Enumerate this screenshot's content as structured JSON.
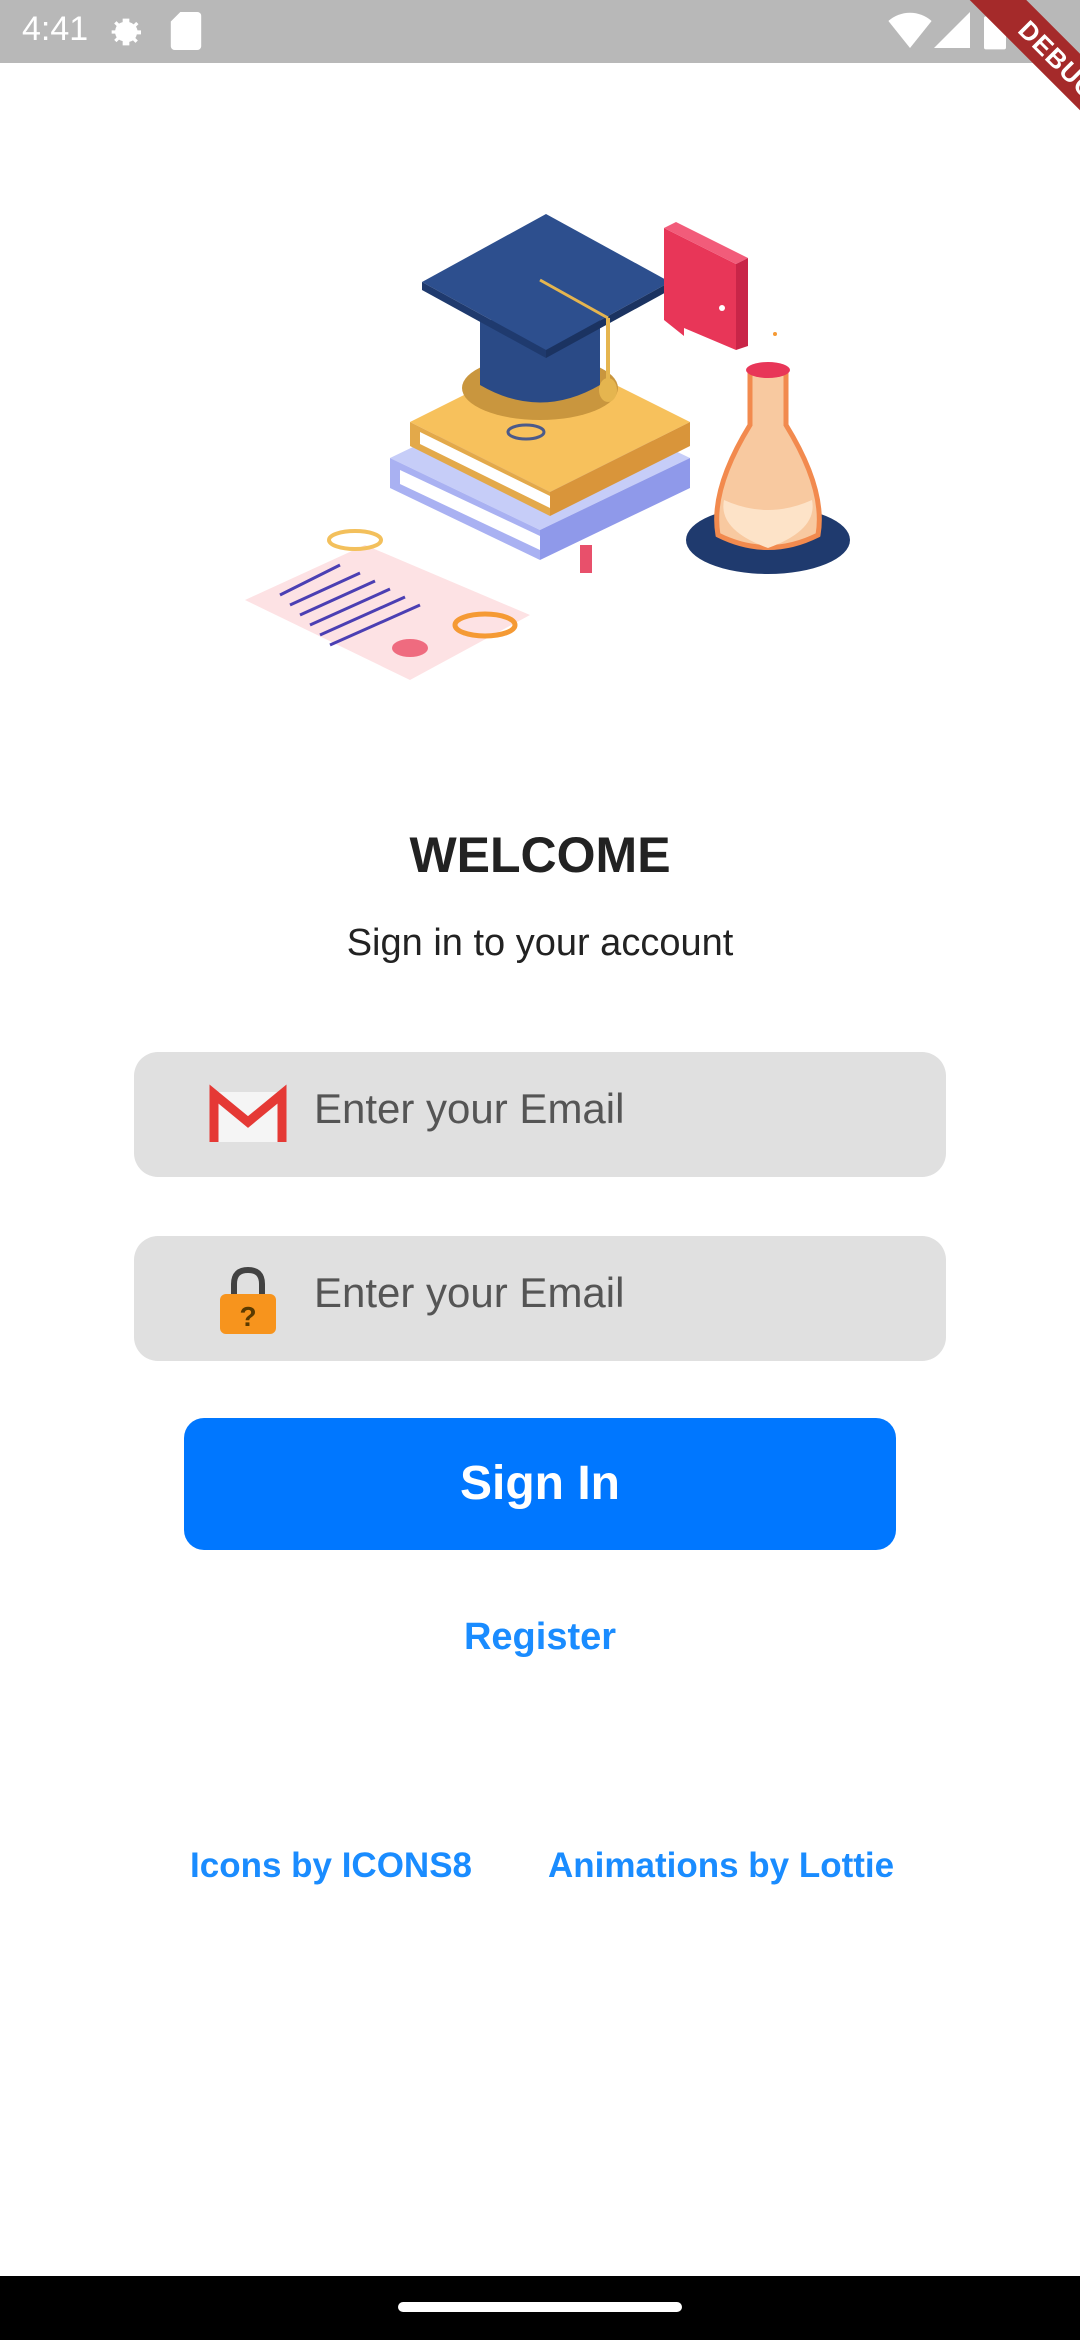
{
  "status_bar": {
    "time": "4:41",
    "icons": [
      "settings-gear-icon",
      "sd-card-icon",
      "wifi-icon",
      "signal-icon",
      "battery-icon"
    ]
  },
  "debug_banner": {
    "label": "DEBUG"
  },
  "hero_illustration": {
    "icon": "graduation-books-flask-illustration"
  },
  "welcome": {
    "title": "WELCOME",
    "subtitle": "Sign in to your account"
  },
  "email_field": {
    "placeholder": "Enter your Email",
    "icon": "gmail-icon"
  },
  "password_field": {
    "placeholder": "Enter your Email",
    "icon": "lock-icon"
  },
  "sign_in_button": {
    "label": "Sign In"
  },
  "register_link": {
    "label": "Register"
  },
  "credits": {
    "icons_label": "Icons by ICONS8",
    "animations_label": "Animations by Lottie"
  },
  "colors": {
    "primary": "#0077ff",
    "link": "#1a8cff",
    "field_bg": "#e0e0e0",
    "status_bar": "#b8b8b8"
  }
}
